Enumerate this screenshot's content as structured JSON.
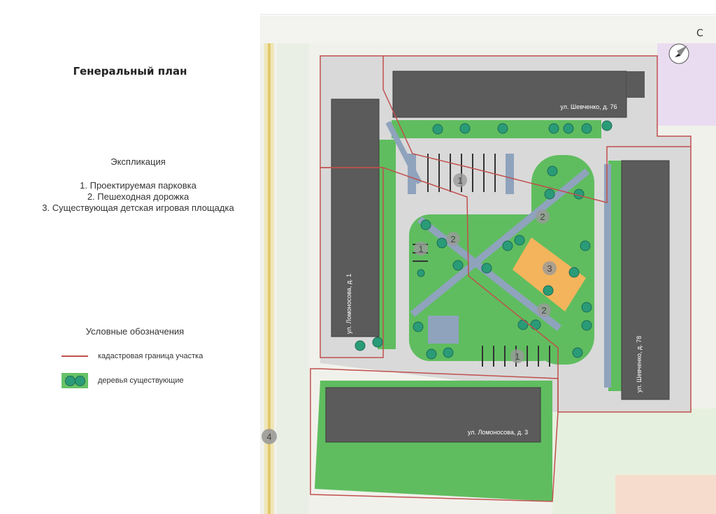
{
  "title": "Генеральный план",
  "explication": {
    "heading": "Экспликация",
    "items": [
      "1. Проектируемая парковка",
      "2. Пешеходная дорожка",
      "3. Существующая детская игровая площадка"
    ]
  },
  "legend": {
    "heading": "Условные обозначения",
    "items": [
      {
        "label": "кадастровая граница участка",
        "symbol": "red-line",
        "color": "#c0504d"
      },
      {
        "label": "деревья существующие",
        "symbol": "tree-swatch",
        "color": "#66c266"
      }
    ]
  },
  "map": {
    "north_label": "С",
    "buildings": [
      {
        "label": "ул. Шевченко, д. 76"
      },
      {
        "label": "ул. Ломоносова, д. 1"
      },
      {
        "label": "ул. Шевченко, д. 78"
      },
      {
        "label": "ул. Ломоносова, д. 3"
      }
    ],
    "markers": [
      "1",
      "2",
      "3",
      "4"
    ],
    "colors": {
      "building": "#5b5b5b",
      "lawn": "#5fbd5f",
      "paving": "#d8d8d8",
      "path": "#8fa3bd",
      "playground": "#f3b45c",
      "boundary": "#c0504d",
      "tree": "#2a9b77"
    }
  }
}
